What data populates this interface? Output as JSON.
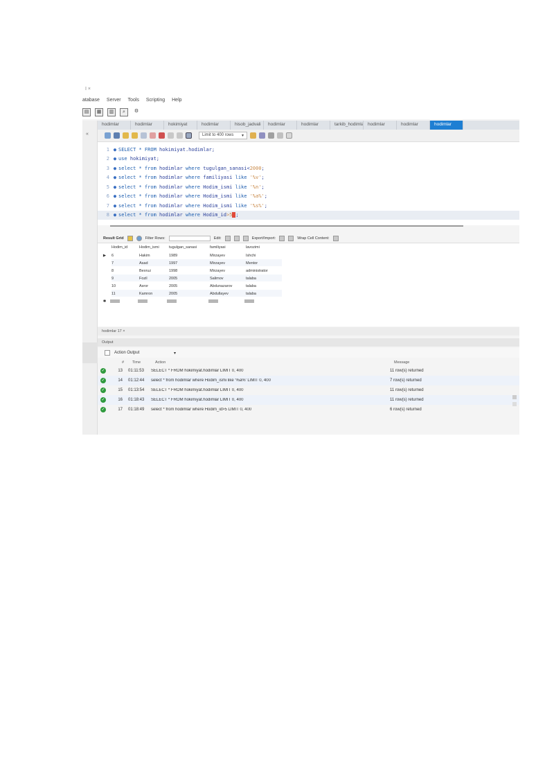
{
  "window": {
    "title": "I ×"
  },
  "menu": [
    "atabase",
    "Server",
    "Tools",
    "Scripting",
    "Help"
  ],
  "left_panel": {
    "label": "«"
  },
  "tabs": [
    {
      "label": "hodimlar",
      "active": false
    },
    {
      "label": "hodimlar",
      "active": false
    },
    {
      "label": "hokimiyat",
      "active": false
    },
    {
      "label": "hodimlar",
      "active": false
    },
    {
      "label": "hisob_jadvali",
      "active": false
    },
    {
      "label": "hodimlar",
      "active": false
    },
    {
      "label": "hodimlar",
      "active": false
    },
    {
      "label": "tarkib_hodimlar",
      "active": false
    },
    {
      "label": "hodimlar",
      "active": false
    },
    {
      "label": "hodimlar",
      "active": false
    },
    {
      "label": "hodimlar",
      "active": true
    }
  ],
  "editor_toolbar": {
    "limit_label": "Limit to 400 rows",
    "dropdown": "▾"
  },
  "editor": {
    "lines": [
      {
        "n": "1",
        "parts": [
          [
            "kw",
            "SELECT * FROM "
          ],
          [
            "code",
            "hokimiyat.hodimlar;"
          ]
        ]
      },
      {
        "n": "2",
        "parts": [
          [
            "kw",
            "use "
          ],
          [
            "code",
            "hokimiyat;"
          ]
        ]
      },
      {
        "n": "3",
        "parts": [
          [
            "kw",
            "select * from "
          ],
          [
            "code",
            "hodimlar "
          ],
          [
            "kw",
            "where "
          ],
          [
            "code",
            "tugulgan_sanasi<"
          ],
          [
            "strv",
            "2000"
          ],
          [
            "code",
            ";"
          ]
        ]
      },
      {
        "n": "4",
        "parts": [
          [
            "kw",
            "select * from "
          ],
          [
            "code",
            "hodimlar "
          ],
          [
            "kw",
            "where "
          ],
          [
            "code",
            "familiyasi "
          ],
          [
            "kw",
            "like "
          ],
          [
            "strv",
            "'%v'"
          ],
          [
            "code",
            ";"
          ]
        ]
      },
      {
        "n": "5",
        "parts": [
          [
            "kw",
            "select * from "
          ],
          [
            "code",
            "hodimlar "
          ],
          [
            "kw",
            "where "
          ],
          [
            "code",
            "Hodim_ismi "
          ],
          [
            "kw",
            "like "
          ],
          [
            "strv",
            "'%n'"
          ],
          [
            "code",
            ";"
          ]
        ]
      },
      {
        "n": "6",
        "parts": [
          [
            "kw",
            "select * from "
          ],
          [
            "code",
            "hodimlar "
          ],
          [
            "kw",
            "where "
          ],
          [
            "code",
            "Hodim_ismi "
          ],
          [
            "kw",
            "like "
          ],
          [
            "strv",
            "'%a%'"
          ],
          [
            "code",
            ";"
          ]
        ]
      },
      {
        "n": "7",
        "parts": [
          [
            "kw",
            "select * from "
          ],
          [
            "code",
            "hodimlar "
          ],
          [
            "kw",
            "where "
          ],
          [
            "code",
            "Hodim_ismi "
          ],
          [
            "kw",
            "like "
          ],
          [
            "strv",
            "'%s%'"
          ],
          [
            "code",
            ";"
          ]
        ]
      },
      {
        "n": "8",
        "parts": [
          [
            "kw",
            "select * from "
          ],
          [
            "code",
            "hodimlar "
          ],
          [
            "kw",
            "where "
          ],
          [
            "code",
            "Hodim_id"
          ],
          [
            "strv",
            ">5"
          ],
          [
            "code",
            ";"
          ]
        ],
        "current": true
      }
    ]
  },
  "result_toolbar": {
    "result_grid": "Result Grid",
    "filter_rows": "Filter Rows:",
    "edit": "Edit:",
    "export_import": "Export/Import:",
    "wrap": "Wrap Cell Content:"
  },
  "grid": {
    "columns": [
      "Hodim_id",
      "Hodim_ismi",
      "tugulgan_sanasi",
      "familiyasi",
      "lavozimi"
    ],
    "rows": [
      [
        "6",
        "Hakim",
        "1989",
        "Mirzayev",
        "Ishchi"
      ],
      [
        "7",
        "Asad",
        "1997",
        "Mirzayev",
        "Mentor"
      ],
      [
        "8",
        "Bexruz",
        "1998",
        "Mirzayev",
        "administrator"
      ],
      [
        "9",
        "Fozil",
        "2005",
        "Salimov",
        "talaba"
      ],
      [
        "10",
        "Asror",
        "2005",
        "Abdunazarov",
        "talaba"
      ],
      [
        "11",
        "Kamron",
        "2005",
        "Abdullayev",
        "talaba"
      ]
    ],
    "row_marker": "▶",
    "new_row_marker": "✱"
  },
  "bottom_tabs": {
    "label": "hodimlar 17 ×"
  },
  "output": {
    "header": "Output",
    "selector": "Action Output",
    "selector_arrow": "▾",
    "columns": {
      "num": "#",
      "time": "Time",
      "action": "Action",
      "message": "Message"
    },
    "rows": [
      {
        "num": "13",
        "time": "01:11:53",
        "action": "SELECT * FROM hokimiyat.hodimlar LIMIT 0, 400",
        "message": "11 row(s) returned",
        "status": "ok"
      },
      {
        "num": "14",
        "time": "01:12:44",
        "action": "select * from hodimlar where Hodim_ismi like '%a%' LIMIT 0, 400",
        "message": "7 row(s) returned",
        "status": "ok"
      },
      {
        "num": "15",
        "time": "01:13:54",
        "action": "SELECT * FROM hokimiyat.hodimlar LIMIT 0, 400",
        "message": "11 row(s) returned",
        "status": "ok"
      },
      {
        "num": "16",
        "time": "01:18:43",
        "action": "SELECT * FROM hokimiyat.hodimlar LIMIT 0, 400",
        "message": "11 row(s) returned",
        "status": "ok"
      },
      {
        "num": "17",
        "time": "01:18:49",
        "action": "select * from hodimlar where Hodim_id>5 LIMIT 0, 400",
        "message": "6 row(s) returned",
        "status": "ok"
      }
    ]
  },
  "colors": {
    "active_tab": "#1e7fd3",
    "ok": "#2f9a3e",
    "keyword": "#1f5fb0",
    "string": "#c98a4a"
  }
}
